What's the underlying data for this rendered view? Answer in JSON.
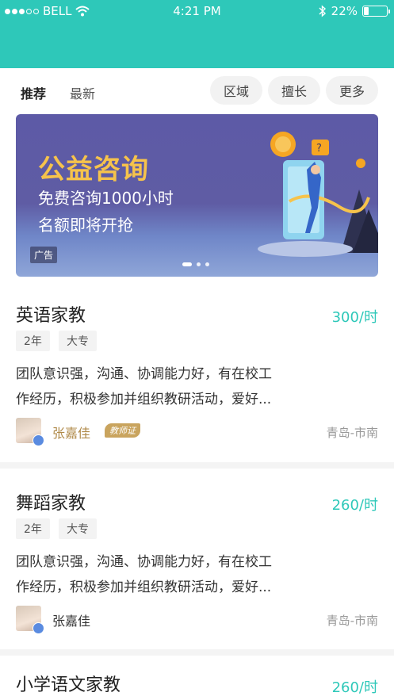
{
  "status_bar": {
    "carrier": "BELL",
    "time": "4:21 PM",
    "battery": "22%",
    "battery_level": 0.22,
    "icons": [
      "signal-dots-icon",
      "wifi-icon",
      "bluetooth-icon",
      "battery-icon"
    ]
  },
  "header": {
    "color": "#2ec8b9"
  },
  "tabs": {
    "recommend": "推荐",
    "latest": "最新"
  },
  "filters": {
    "region": "区域",
    "specialty": "擅长",
    "more": "更多"
  },
  "banner": {
    "title": "公益咨询",
    "line1": "免费咨询1000小时",
    "line2": "名额即将开抢",
    "ad_label": "广告",
    "page_count": 3,
    "active_page": 1
  },
  "listings": [
    {
      "title": "英语家教",
      "price": "300/时",
      "tags": [
        "2年",
        "大专"
      ],
      "description_line1": "团队意识强，沟通、协调能力好，有在校工",
      "description_line2": "作经历，积极参加并组织教研活动，爱好...",
      "teacher": "张嘉佳",
      "badge": "教师证",
      "location": "青岛-市南"
    },
    {
      "title": "舞蹈家教",
      "price": "260/时",
      "tags": [
        "2年",
        "大专"
      ],
      "description_line1": "团队意识强，沟通、协调能力好，有在校工",
      "description_line2": "作经历，积极参加并组织教研活动，爱好...",
      "teacher": "张嘉佳",
      "location": "青岛-市南"
    },
    {
      "title": "小学语文家教",
      "price": "260/时"
    }
  ],
  "colors": {
    "accent": "#2ec8b9",
    "banner_title": "#f6c34b",
    "badge": "#c9a45e"
  }
}
